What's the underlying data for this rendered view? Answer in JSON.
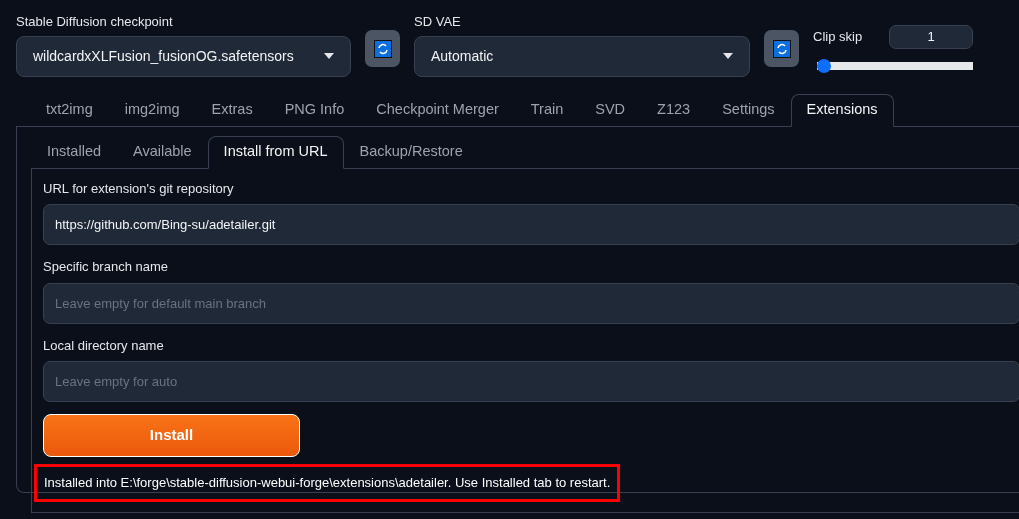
{
  "checkpoint": {
    "label": "Stable Diffusion checkpoint",
    "value": "wildcardxXLFusion_fusionOG.safetensors"
  },
  "vae": {
    "label": "SD VAE",
    "value": "Automatic"
  },
  "clip_skip": {
    "label": "Clip skip",
    "value": "1",
    "level": 0
  },
  "tabs": [
    {
      "label": "txt2img",
      "selected": false
    },
    {
      "label": "img2img",
      "selected": false
    },
    {
      "label": "Extras",
      "selected": false
    },
    {
      "label": "PNG Info",
      "selected": false
    },
    {
      "label": "Checkpoint Merger",
      "selected": false
    },
    {
      "label": "Train",
      "selected": false
    },
    {
      "label": "SVD",
      "selected": false
    },
    {
      "label": "Z123",
      "selected": false
    },
    {
      "label": "Settings",
      "selected": false
    },
    {
      "label": "Extensions",
      "selected": true
    }
  ],
  "subtabs": [
    {
      "label": "Installed",
      "selected": false
    },
    {
      "label": "Available",
      "selected": false
    },
    {
      "label": "Install from URL",
      "selected": true
    },
    {
      "label": "Backup/Restore",
      "selected": false
    }
  ],
  "fields": [
    {
      "label": "URL for extension's git repository",
      "value": "https://github.com/Bing-su/adetailer.git"
    },
    {
      "label": "Specific branch name",
      "placeholder": "Leave empty for default main branch"
    },
    {
      "label": "Local directory name",
      "placeholder": "Leave empty for auto"
    }
  ],
  "install_button": "Install",
  "message": {
    "text": "Installed into E:\\forge\\stable-diffusion-webui-forge\\extensions\\adetailer. Use Installed tab to restart.",
    "highlighted": true
  }
}
